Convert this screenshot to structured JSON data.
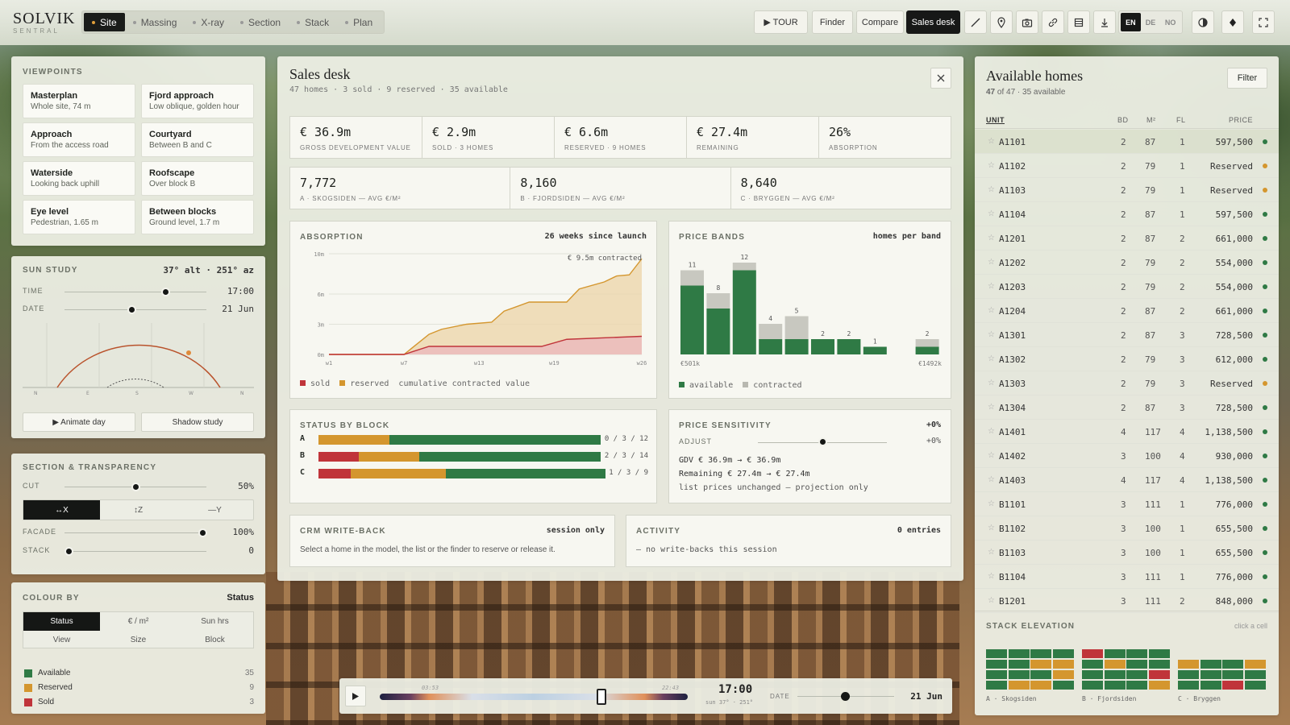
{
  "app": {
    "logo": "SOLVIK",
    "logo_sub": "SENTRAL"
  },
  "modes": [
    {
      "label": "Site",
      "active": true
    },
    {
      "label": "Massing"
    },
    {
      "label": "X-ray"
    },
    {
      "label": "Section"
    },
    {
      "label": "Stack"
    },
    {
      "label": "Plan"
    }
  ],
  "toolbar": {
    "tour": "▶ TOUR",
    "finder": "Finder",
    "compare": "Compare",
    "sales": "Sales desk",
    "icons": [
      "measure-icon",
      "pin-icon",
      "camera-icon",
      "link-icon",
      "table-icon",
      "download-icon"
    ],
    "langs": [
      "EN",
      "DE",
      "NO"
    ],
    "active_lang": "EN"
  },
  "viewpoints": {
    "title": "VIEWPOINTS",
    "items": [
      {
        "t": "Masterplan",
        "s": "Whole site, 74 m"
      },
      {
        "t": "Fjord approach",
        "s": "Low oblique, golden hour"
      },
      {
        "t": "Approach",
        "s": "From the access road"
      },
      {
        "t": "Courtyard",
        "s": "Between B and C"
      },
      {
        "t": "Waterside",
        "s": "Looking back uphill"
      },
      {
        "t": "Roofscape",
        "s": "Over block B"
      },
      {
        "t": "Eye level",
        "s": "Pedestrian, 1.65 m"
      },
      {
        "t": "Between blocks",
        "s": "Ground level, 1.7 m"
      }
    ]
  },
  "sun": {
    "title": "SUN STUDY",
    "readout": "37° alt · 251° az",
    "time_label": "TIME",
    "time": "17:00",
    "time_pos": 0.71,
    "date_label": "DATE",
    "date": "21 Jun",
    "date_pos": 0.47,
    "animate": "▶ Animate day",
    "shadow": "Shadow study",
    "axis": [
      "N",
      "E",
      "S",
      "W",
      "N"
    ]
  },
  "section": {
    "title": "SECTION & TRANSPARENCY",
    "cut_label": "CUT",
    "cut": "50%",
    "cut_pos": 0.5,
    "axes": [
      "↔X",
      "↕Z",
      "—Y"
    ],
    "active_axis": 0,
    "facade_label": "FACADE",
    "facade": "100%",
    "facade_pos": 0.97,
    "stack_label": "STACK",
    "stack": "0",
    "stack_pos": 0.03
  },
  "colour": {
    "title": "COLOUR BY",
    "value": "Status",
    "opts": [
      "Status",
      "€ / m²",
      "Sun hrs",
      "View",
      "Size",
      "Block"
    ],
    "legend": [
      {
        "n": "Available",
        "c": "35",
        "col": "#2f7a45"
      },
      {
        "n": "Reserved",
        "c": "9",
        "col": "#d4962e"
      },
      {
        "n": "Sold",
        "c": "3",
        "col": "#c0343a"
      }
    ]
  },
  "sales": {
    "title": "Sales desk",
    "subtitle": "47 homes · 3 sold · 9 reserved · 35 available",
    "kpis": [
      {
        "v": "€ 36.9m",
        "l": "GROSS DEVELOPMENT VALUE"
      },
      {
        "v": "€ 2.9m",
        "l": "SOLD · 3 HOMES"
      },
      {
        "v": "€ 6.6m",
        "l": "RESERVED · 9 HOMES"
      },
      {
        "v": "€ 27.4m",
        "l": "REMAINING"
      },
      {
        "v": "26%",
        "l": "ABSORPTION"
      }
    ],
    "avgs": [
      {
        "v": "7,772",
        "l": "A · SKOGSIDEN — AVG €/M²"
      },
      {
        "v": "8,160",
        "l": "B · FJORDSIDEN — AVG €/M²"
      },
      {
        "v": "8,640",
        "l": "C · BRYGGEN — AVG €/M²"
      }
    ],
    "absorption": {
      "title": "ABSORPTION",
      "right": "26 weeks since launch",
      "note": "€ 9.5m contracted",
      "legend": [
        "sold",
        "reserved",
        "cumulative contracted value"
      ]
    },
    "bands": {
      "title": "PRICE BANDS",
      "right": "homes per band",
      "xmin": "€501k",
      "xmax": "€1492k",
      "legend": [
        "available",
        "contracted"
      ]
    },
    "status": {
      "title": "STATUS BY BLOCK",
      "rows": [
        {
          "block": "A",
          "sold": 0,
          "reserved": 3,
          "total": 12,
          "label": "0 / 3 / 12"
        },
        {
          "block": "B",
          "sold": 2,
          "reserved": 3,
          "total": 14,
          "label": "2 / 3 / 14"
        },
        {
          "block": "C",
          "sold": 1,
          "reserved": 3,
          "total": 9,
          "label": "1 / 3 / 9"
        }
      ]
    },
    "sensitivity": {
      "title": "PRICE SENSITIVITY",
      "right": "+0%",
      "adjust": "ADJUST",
      "adj_val": "+0%",
      "adj_pos": 0.5,
      "l1": "GDV € 36.9m → € 36.9m",
      "l2": "Remaining € 27.4m → € 27.4m",
      "l3": "list prices unchanged — projection only"
    },
    "crm": {
      "title": "CRM WRITE-BACK",
      "right": "session only",
      "text": "Select a home in the model, the list or the finder to reserve or release it."
    },
    "activity": {
      "title": "ACTIVITY",
      "right": "0 entries",
      "text": "— no write-backs this session"
    }
  },
  "chart_data": [
    {
      "type": "area",
      "title": "ABSORPTION",
      "x": [
        "w1",
        "w7",
        "w13",
        "w19",
        "w26"
      ],
      "y_ticks": [
        "0m",
        "3m",
        "6m",
        "10m"
      ],
      "ylim": [
        0,
        10
      ],
      "series": [
        {
          "name": "sold",
          "values": [
            [
              1,
              0
            ],
            [
              7,
              0
            ],
            [
              9,
              0.8
            ],
            [
              18,
              0.8
            ],
            [
              20,
              1.5
            ],
            [
              26,
              1.8
            ]
          ]
        },
        {
          "name": "reserved",
          "values": [
            [
              1,
              0
            ],
            [
              7,
              0
            ],
            [
              9,
              2
            ],
            [
              10,
              2.5
            ],
            [
              12,
              3
            ],
            [
              14,
              3.2
            ],
            [
              15,
              4.3
            ],
            [
              17,
              5.2
            ],
            [
              20,
              5.2
            ],
            [
              21,
              6.5
            ],
            [
              23,
              7.2
            ],
            [
              24,
              7.8
            ],
            [
              25,
              7.9
            ],
            [
              26,
              9.5
            ]
          ]
        }
      ]
    },
    {
      "type": "bar",
      "title": "PRICE BANDS",
      "x": [
        "€501k",
        "€1492k"
      ],
      "series": [
        {
          "name": "available",
          "values": [
            9,
            6,
            11,
            2,
            2,
            2,
            2,
            1,
            0,
            1
          ]
        },
        {
          "name": "contracted",
          "values": [
            2,
            2,
            1,
            2,
            3,
            0,
            0,
            0,
            0,
            1
          ]
        }
      ],
      "totals": [
        11,
        8,
        12,
        4,
        5,
        2,
        2,
        1,
        0,
        2
      ]
    }
  ],
  "homes": {
    "title": "Available homes",
    "count": "47",
    "sub": " of 47 · 35 available",
    "filter": "Filter",
    "cols": [
      "UNIT",
      "BD",
      "M²",
      "FL",
      "PRICE"
    ],
    "rows": [
      {
        "u": "A1101",
        "bd": "2",
        "m2": "87",
        "fl": "1",
        "p": "597,500",
        "s": "a"
      },
      {
        "u": "A1102",
        "bd": "2",
        "m2": "79",
        "fl": "1",
        "p": "Reserved",
        "s": "r"
      },
      {
        "u": "A1103",
        "bd": "2",
        "m2": "79",
        "fl": "1",
        "p": "Reserved",
        "s": "r"
      },
      {
        "u": "A1104",
        "bd": "2",
        "m2": "87",
        "fl": "1",
        "p": "597,500",
        "s": "a"
      },
      {
        "u": "A1201",
        "bd": "2",
        "m2": "87",
        "fl": "2",
        "p": "661,000",
        "s": "a"
      },
      {
        "u": "A1202",
        "bd": "2",
        "m2": "79",
        "fl": "2",
        "p": "554,000",
        "s": "a"
      },
      {
        "u": "A1203",
        "bd": "2",
        "m2": "79",
        "fl": "2",
        "p": "554,000",
        "s": "a"
      },
      {
        "u": "A1204",
        "bd": "2",
        "m2": "87",
        "fl": "2",
        "p": "661,000",
        "s": "a"
      },
      {
        "u": "A1301",
        "bd": "2",
        "m2": "87",
        "fl": "3",
        "p": "728,500",
        "s": "a"
      },
      {
        "u": "A1302",
        "bd": "2",
        "m2": "79",
        "fl": "3",
        "p": "612,000",
        "s": "a"
      },
      {
        "u": "A1303",
        "bd": "2",
        "m2": "79",
        "fl": "3",
        "p": "Reserved",
        "s": "r"
      },
      {
        "u": "A1304",
        "bd": "2",
        "m2": "87",
        "fl": "3",
        "p": "728,500",
        "s": "a"
      },
      {
        "u": "A1401",
        "bd": "4",
        "m2": "117",
        "fl": "4",
        "p": "1,138,500",
        "s": "a"
      },
      {
        "u": "A1402",
        "bd": "3",
        "m2": "100",
        "fl": "4",
        "p": "930,000",
        "s": "a"
      },
      {
        "u": "A1403",
        "bd": "4",
        "m2": "117",
        "fl": "4",
        "p": "1,138,500",
        "s": "a"
      },
      {
        "u": "B1101",
        "bd": "3",
        "m2": "111",
        "fl": "1",
        "p": "776,000",
        "s": "a"
      },
      {
        "u": "B1102",
        "bd": "3",
        "m2": "100",
        "fl": "1",
        "p": "655,500",
        "s": "a"
      },
      {
        "u": "B1103",
        "bd": "3",
        "m2": "100",
        "fl": "1",
        "p": "655,500",
        "s": "a"
      },
      {
        "u": "B1104",
        "bd": "3",
        "m2": "111",
        "fl": "1",
        "p": "776,000",
        "s": "a"
      },
      {
        "u": "B1201",
        "bd": "3",
        "m2": "111",
        "fl": "2",
        "p": "848,000",
        "s": "a"
      }
    ]
  },
  "stack": {
    "title": "STACK ELEVATION",
    "hint": "click a cell",
    "blocks": [
      {
        "name": "A · Skogsiden",
        "rows": [
          "gggg",
          "ggrr",
          "gggr",
          "grrg"
        ]
      },
      {
        "name": "B · Fjordsiden",
        "rows": [
          "sggg",
          "grgg",
          "gggs",
          "gggr"
        ]
      },
      {
        "name": "C · Bryggen",
        "rows": [
          "rggr",
          "gggg",
          "ggsg"
        ]
      }
    ]
  },
  "timeline": {
    "time": "17:00",
    "sub": "sun 37° · 251°",
    "t1": "03:53",
    "t2": "22:43",
    "date_label": "DATE",
    "date": "21 Jun",
    "pos": 0.72
  },
  "colors": {
    "available": "#2f7a45",
    "reserved": "#d4962e",
    "sold": "#c0343a",
    "ink": "#171817"
  }
}
